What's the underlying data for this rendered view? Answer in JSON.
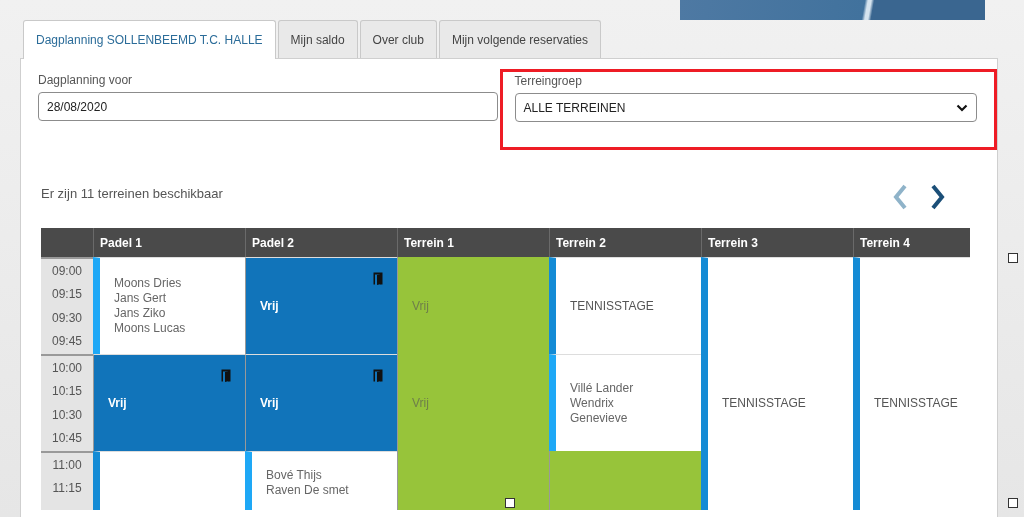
{
  "tabs": [
    {
      "label": "Dagplanning SOLLENBEEMD T.C. HALLE",
      "selected": true
    },
    {
      "label": "Mijn saldo",
      "selected": false
    },
    {
      "label": "Over club",
      "selected": false
    },
    {
      "label": "Mijn volgende reservaties",
      "selected": false
    }
  ],
  "date_field": {
    "label": "Dagplanning voor",
    "value": "28/08/2020"
  },
  "group_field": {
    "label": "Terreingroep",
    "value": "ALLE TERREINEN"
  },
  "availability": "Er zijn 11 terreinen beschikbaar",
  "schedule": {
    "columns": [
      "Padel 1",
      "Padel 2",
      "Terrein 1",
      "Terrein 2",
      "Terrein 3",
      "Terrein 4"
    ],
    "rows": [
      {
        "times": [
          "09:00",
          "09:15",
          "09:30",
          "09:45"
        ],
        "cells": [
          {
            "kind": "reservation",
            "lines": [
              "Moons Dries",
              "Jans Gert",
              "Jans Ziko",
              "Moons Lucas"
            ]
          },
          {
            "kind": "free",
            "label": "Vrij"
          },
          {
            "kind": "open",
            "label": "Vrij"
          },
          {
            "kind": "event",
            "label": "TENNISSTAGE"
          },
          {
            "kind": "event",
            "label": "TENNISSTAGE"
          },
          {
            "kind": "event",
            "label": "TENNISSTAGE"
          }
        ]
      },
      {
        "times": [
          "10:00",
          "10:15",
          "10:30",
          "10:45"
        ],
        "cells": [
          {
            "kind": "free",
            "label": "Vrij"
          },
          {
            "kind": "free",
            "label": "Vrij"
          },
          {
            "kind": "open",
            "label": "Vrij"
          },
          {
            "kind": "reservation",
            "lines": [
              "Villé Lander",
              "Wendrix",
              "Genevieve"
            ]
          },
          {
            "kind": "merged"
          },
          {
            "kind": "merged"
          }
        ]
      },
      {
        "times": [
          "11:00",
          "11:15"
        ],
        "cells": [
          {
            "kind": "event"
          },
          {
            "kind": "reservation",
            "lines": [
              "Bové Thijs",
              "Raven De smet"
            ]
          },
          {
            "kind": "open"
          },
          {
            "kind": "open"
          },
          {
            "kind": "merged"
          },
          {
            "kind": "merged"
          }
        ]
      }
    ]
  }
}
